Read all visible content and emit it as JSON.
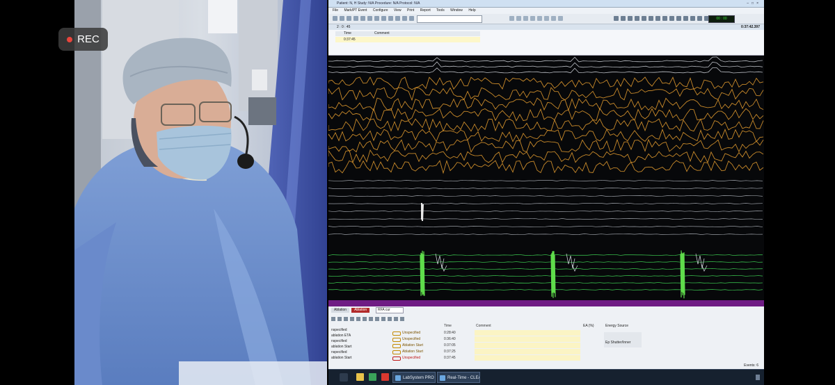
{
  "recording": {
    "label": "REC",
    "dot_color": "#e8453c"
  },
  "screen": {
    "title": "Patient: N, H   Study: N/A   Procedure: N/A   Protocol: N/A",
    "menu": [
      "File",
      "Mark/PT Event",
      "Configure",
      "View",
      "Print",
      "Report",
      "Tools",
      "Window",
      "Help"
    ],
    "clock": "0:37:42.397",
    "display_value": "00 : 00",
    "event_log": {
      "left_header": "2 : 0 : 45",
      "columns": {
        "time": "Time",
        "comment": "Comment"
      },
      "row": {
        "time": "0:37:45"
      }
    },
    "bottom": {
      "tabs": [
        "Ablation",
        "Ablation"
      ],
      "select_value": "RFA cur",
      "left_list": [
        "nspecified",
        "ablation ETA",
        "nspecified",
        "ablation Start",
        "nspecified",
        "ablation Start"
      ],
      "columns": {
        "time": "Time",
        "comment": "Comment",
        "energy": "Energy Source",
        "dur": "EA (%)"
      },
      "rows": [
        {
          "type": "Unspecified",
          "time": "0:28:40",
          "highlight": false
        },
        {
          "type": "Unspecified",
          "time": "0:36:40",
          "highlight": false
        },
        {
          "type": "Ablation Start",
          "time": "0:37:05",
          "highlight": false
        },
        {
          "type": "Ablation Start",
          "time": "0:37:25",
          "highlight": false
        },
        {
          "type": "Unspecified",
          "time": "0:37:45",
          "highlight": true
        }
      ],
      "energy_source": "Ep Shutter/Inner",
      "events_label": "Events: 6"
    },
    "taskbar": {
      "tasks": [
        "LabSystem PRO v4...",
        "Real-Time - CLEA..."
      ]
    }
  },
  "colors": {
    "trace_gray": "#b9bcc2",
    "trace_orange": "#c98a2a",
    "trace_green": "#37b94a",
    "ablation_purple": "#6f1c84",
    "gown_blue": "#6f93cf"
  }
}
